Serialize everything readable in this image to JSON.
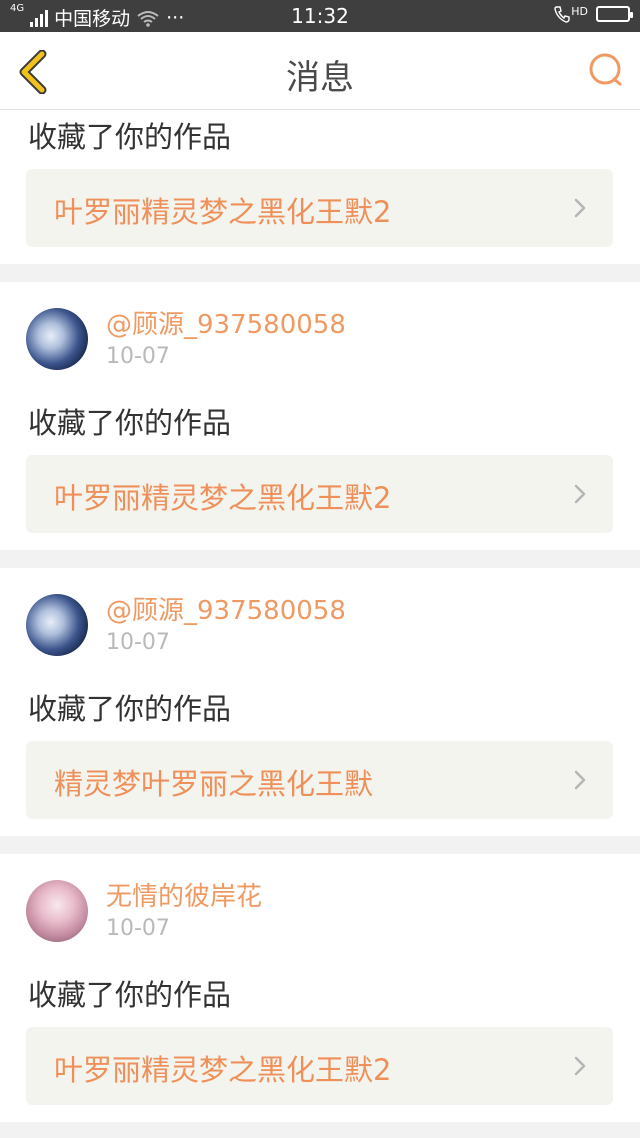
{
  "status_bar": {
    "network": "4G",
    "carrier": "中国移动",
    "dots": "···",
    "time": "11:32",
    "hd": "HD"
  },
  "header": {
    "title": "消息",
    "back_icon": "chevron-left-icon",
    "search_icon": "search-icon",
    "accent_back": "#f2c21a",
    "accent_search": "#f09a63"
  },
  "notifications": [
    {
      "action": "收藏了你的作品",
      "work_title": "叶罗丽精灵梦之黑化王默2"
    },
    {
      "user": "@顾源_937580058",
      "date": "10-07",
      "action": "收藏了你的作品",
      "work_title": "叶罗丽精灵梦之黑化王默2"
    },
    {
      "user": "@顾源_937580058",
      "date": "10-07",
      "action": "收藏了你的作品",
      "work_title": "精灵梦叶罗丽之黑化王默"
    },
    {
      "user": "无情的彼岸花",
      "date": "10-07",
      "action": "收藏了你的作品",
      "work_title": "叶罗丽精灵梦之黑化王默2"
    }
  ],
  "colors": {
    "username": "#f09a63",
    "work_title": "#ef905a",
    "date": "#b9b9b9"
  }
}
